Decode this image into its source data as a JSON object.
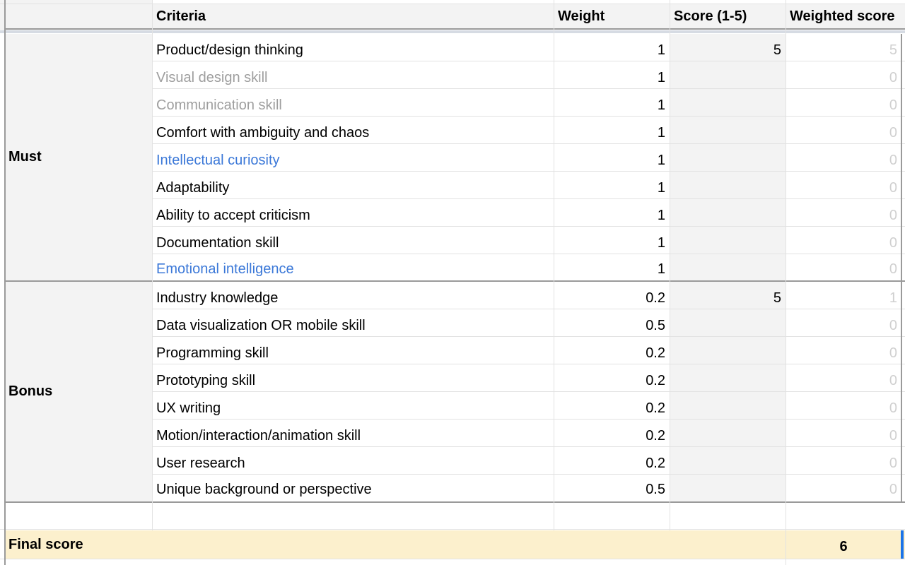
{
  "header": {
    "criteria": "Criteria",
    "weight": "Weight",
    "score": "Score (1-5)",
    "weighted_score": "Weighted score"
  },
  "groups": {
    "must": "Must",
    "bonus": "Bonus"
  },
  "must_rows": [
    {
      "criteria": "Product/design thinking",
      "weight": "1",
      "score": "5",
      "weighted": "5",
      "style": "normal"
    },
    {
      "criteria": "Visual design skill",
      "weight": "1",
      "score": "",
      "weighted": "0",
      "style": "grey"
    },
    {
      "criteria": "Communication skill",
      "weight": "1",
      "score": "",
      "weighted": "0",
      "style": "grey"
    },
    {
      "criteria": "Comfort with ambiguity and chaos",
      "weight": "1",
      "score": "",
      "weighted": "0",
      "style": "normal"
    },
    {
      "criteria": "Intellectual curiosity",
      "weight": "1",
      "score": "",
      "weighted": "0",
      "style": "blue"
    },
    {
      "criteria": "Adaptability",
      "weight": "1",
      "score": "",
      "weighted": "0",
      "style": "normal"
    },
    {
      "criteria": "Ability to accept criticism",
      "weight": "1",
      "score": "",
      "weighted": "0",
      "style": "normal"
    },
    {
      "criteria": "Documentation skill",
      "weight": "1",
      "score": "",
      "weighted": "0",
      "style": "normal"
    },
    {
      "criteria": "Emotional intelligence",
      "weight": "1",
      "score": "",
      "weighted": "0",
      "style": "blue"
    }
  ],
  "bonus_rows": [
    {
      "criteria": "Industry knowledge",
      "weight": "0.2",
      "score": "5",
      "weighted": "1",
      "style": "normal"
    },
    {
      "criteria": "Data visualization OR mobile skill",
      "weight": "0.5",
      "score": "",
      "weighted": "0",
      "style": "normal"
    },
    {
      "criteria": "Programming skill",
      "weight": "0.2",
      "score": "",
      "weighted": "0",
      "style": "normal"
    },
    {
      "criteria": "Prototyping skill",
      "weight": "0.2",
      "score": "",
      "weighted": "0",
      "style": "normal"
    },
    {
      "criteria": "UX writing",
      "weight": "0.2",
      "score": "",
      "weighted": "0",
      "style": "normal"
    },
    {
      "criteria": "Motion/interaction/animation skill",
      "weight": "0.2",
      "score": "",
      "weighted": "0",
      "style": "normal"
    },
    {
      "criteria": "User research",
      "weight": "0.2",
      "score": "",
      "weighted": "0",
      "style": "normal"
    },
    {
      "criteria": "Unique background or perspective",
      "weight": "0.5",
      "score": "",
      "weighted": "0",
      "style": "normal"
    }
  ],
  "final": {
    "label": "Final score",
    "value": "6"
  },
  "colors": {
    "group_bg": "#f3f3f3",
    "score_bg": "#f3f3f3",
    "final_bg": "#fcf0cd",
    "blue_text": "#3b78d8",
    "grey_text": "#9e9e9e",
    "faint_text": "#d0d0d0",
    "selection_blue": "#1a73e8"
  }
}
